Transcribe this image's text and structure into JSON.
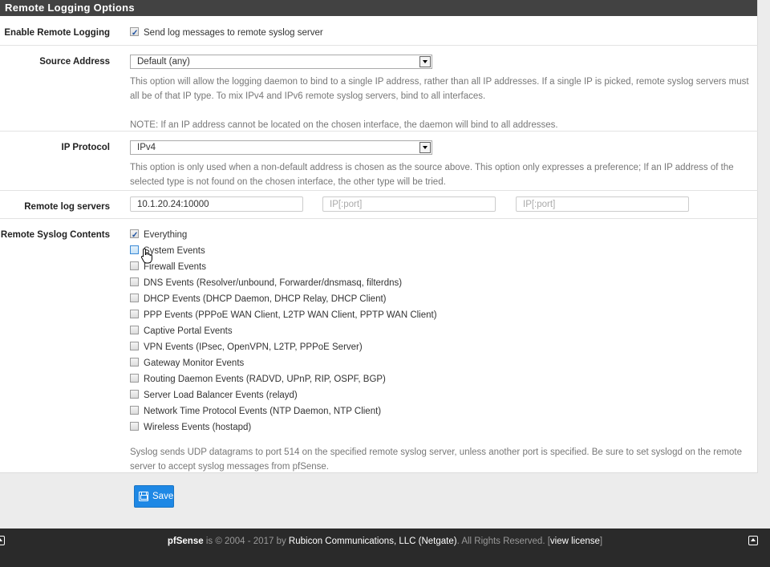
{
  "panel": {
    "title": "Remote Logging Options"
  },
  "enable_remote_logging": {
    "label": "Enable Remote Logging",
    "checkbox_label": "Send log messages to remote syslog server",
    "checked": true
  },
  "source_address": {
    "label": "Source Address",
    "selected": "Default (any)",
    "help1": "This option will allow the logging daemon to bind to a single IP address, rather than all IP addresses. If a single IP is picked, remote syslog servers must all be of that IP type. To mix IPv4 and IPv6 remote syslog servers, bind to all interfaces.",
    "help2": "NOTE: If an IP address cannot be located on the chosen interface, the daemon will bind to all addresses."
  },
  "ip_protocol": {
    "label": "IP Protocol",
    "selected": "IPv4",
    "help": "This option is only used when a non-default address is chosen as the source above. This option only expresses a preference; If an IP address of the selected type is not found on the chosen interface, the other type will be tried."
  },
  "remote_servers": {
    "label": "Remote log servers",
    "server1_value": "10.1.20.24:10000",
    "server2_placeholder": "IP[:port]",
    "server3_placeholder": "IP[:port]"
  },
  "syslog_contents": {
    "label": "Remote Syslog Contents",
    "items": [
      {
        "label": "Everything",
        "checked": true
      },
      {
        "label": "System Events",
        "checked": false
      },
      {
        "label": "Firewall Events",
        "checked": false
      },
      {
        "label": "DNS Events (Resolver/unbound, Forwarder/dnsmasq, filterdns)",
        "checked": false
      },
      {
        "label": "DHCP Events (DHCP Daemon, DHCP Relay, DHCP Client)",
        "checked": false
      },
      {
        "label": "PPP Events (PPPoE WAN Client, L2TP WAN Client, PPTP WAN Client)",
        "checked": false
      },
      {
        "label": "Captive Portal Events",
        "checked": false
      },
      {
        "label": "VPN Events (IPsec, OpenVPN, L2TP, PPPoE Server)",
        "checked": false
      },
      {
        "label": "Gateway Monitor Events",
        "checked": false
      },
      {
        "label": "Routing Daemon Events (RADVD, UPnP, RIP, OSPF, BGP)",
        "checked": false
      },
      {
        "label": "Server Load Balancer Events (relayd)",
        "checked": false
      },
      {
        "label": "Network Time Protocol Events (NTP Daemon, NTP Client)",
        "checked": false
      },
      {
        "label": "Wireless Events (hostapd)",
        "checked": false
      }
    ],
    "help": "Syslog sends UDP datagrams to port 514 on the specified remote syslog server, unless another port is specified. Be sure to set syslogd on the remote server to accept syslog messages from pfSense."
  },
  "save_button": {
    "label": "Save"
  },
  "footer": {
    "brand": "pfSense",
    "is_text": " is © 2004 - 2017 by ",
    "company": "Rubicon Communications, LLC (Netgate)",
    "rights": ". All Rights Reserved. [",
    "license_link": "view license",
    "close_bracket": "]"
  }
}
